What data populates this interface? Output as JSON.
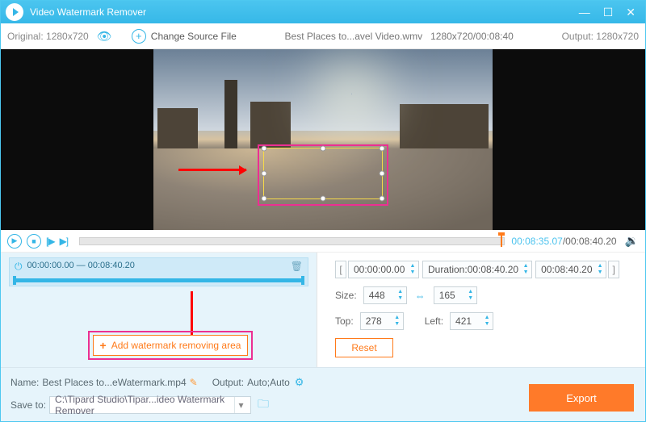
{
  "title": "Video Watermark Remover",
  "toolbar": {
    "original": "Original: 1280x720",
    "change_source": "Change Source File",
    "file_label": "Best Places to...avel Video.wmv",
    "file_meta": "1280x720/00:08:40",
    "output": "Output: 1280x720"
  },
  "playback": {
    "current": "00:08:35.07",
    "total": "/00:08:40.20"
  },
  "clip": {
    "start": "00:00:00.00",
    "sep": " — ",
    "end": "00:08:40.20"
  },
  "rp": {
    "start": "00:00:00.00",
    "dur_label": "Duration:",
    "dur_val": "00:08:40.20",
    "end": "00:08:40.20",
    "size_label": "Size:",
    "w": "448",
    "h": "165",
    "top_label": "Top:",
    "top": "278",
    "left_label": "Left:",
    "left": "421",
    "reset": "Reset"
  },
  "add_area": "Add watermark removing area",
  "bottom": {
    "name_label": "Name:",
    "name_val": "Best Places to...eWatermark.mp4",
    "output_label": "Output:",
    "output_val": "Auto;Auto",
    "save_label": "Save to:",
    "save_path": "C:\\Tipard Studio\\Tipar...ideo Watermark Remover",
    "export": "Export"
  }
}
